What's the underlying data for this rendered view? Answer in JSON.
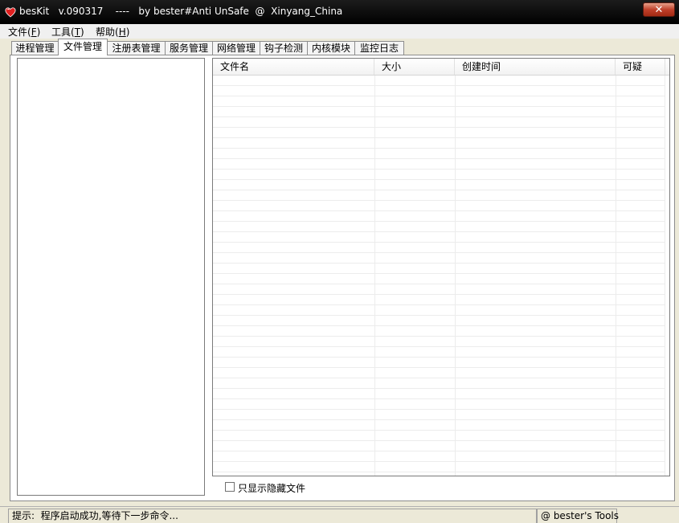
{
  "window": {
    "title": "besKit   v.090317    ----   by bester#Anti UnSafe  @  Xinyang_China",
    "close_label": "✕",
    "icon": "heart-icon",
    "accent": "#c0402a"
  },
  "menu": [
    {
      "label": "文件(",
      "key": "F",
      "end": ")"
    },
    {
      "label": "工具(",
      "key": "T",
      "end": ")"
    },
    {
      "label": "帮助(",
      "key": "H",
      "end": ")"
    }
  ],
  "tabs": [
    {
      "label": "进程管理"
    },
    {
      "label": "文件管理",
      "active": true
    },
    {
      "label": "注册表管理"
    },
    {
      "label": "服务管理"
    },
    {
      "label": "网络管理"
    },
    {
      "label": "钩子检测"
    },
    {
      "label": "内核模块"
    },
    {
      "label": "监控日志"
    }
  ],
  "file_list": {
    "columns": [
      "文件名",
      "大小",
      "创建时间",
      "可疑"
    ],
    "rows": []
  },
  "options": {
    "hidden_only_label": "只显示隐藏文件",
    "hidden_only_checked": false
  },
  "status": {
    "message": "提示:  程序启动成功,等待下一步命令...",
    "credit": "@ bester's Tools"
  }
}
